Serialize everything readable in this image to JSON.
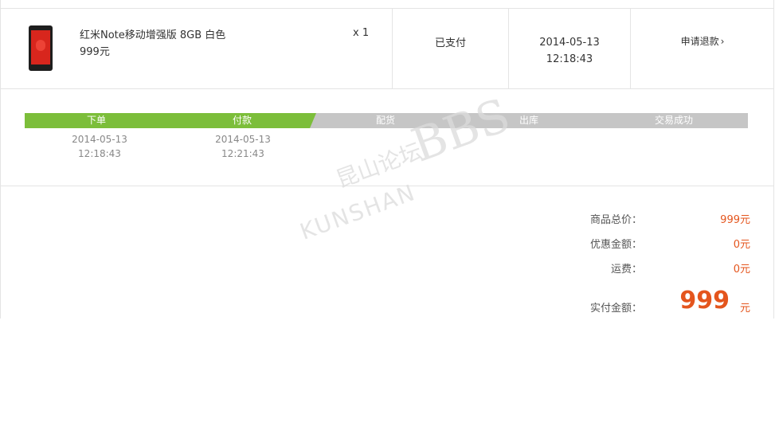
{
  "order_item": {
    "product_name": "红米Note移动增强版 8GB 白色",
    "price": "999元",
    "quantity": "x 1",
    "status": "已支付",
    "date": "2014-05-13",
    "time": "12:18:43",
    "refund_label": "申请退款",
    "refund_chevron": "›"
  },
  "progress": {
    "steps": [
      {
        "label": "下单",
        "completed": true,
        "date": "2014-05-13",
        "time": "12:18:43"
      },
      {
        "label": "付款",
        "completed": true,
        "date": "2014-05-13",
        "time": "12:21:43"
      },
      {
        "label": "配货",
        "completed": false
      },
      {
        "label": "出库",
        "completed": false
      },
      {
        "label": "交易成功",
        "completed": false
      }
    ],
    "completed_color": "#7cbe3a",
    "pending_color": "#c6c6c6"
  },
  "summary": {
    "subtotal_label": "商品总价：",
    "subtotal_value": "999元",
    "discount_label": "优惠金额：",
    "discount_value": "0元",
    "shipping_label": "运费：",
    "shipping_value": "0元",
    "paid_label": "实付金额：",
    "paid_value": "999",
    "paid_unit": "元",
    "accent_color": "#e4551d"
  },
  "watermark": {
    "chinese": "昆山论坛",
    "bbs": "BBS",
    "english": "KUNSHAN"
  }
}
